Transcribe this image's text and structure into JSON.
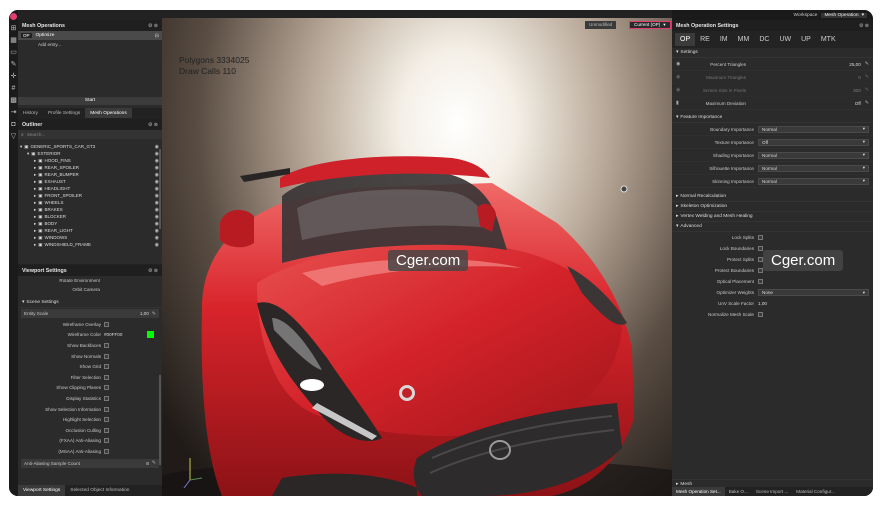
{
  "top_bar": {
    "workspace_label": "Workspace",
    "workspace_value": "Mesh Operation"
  },
  "left_panel": {
    "title": "Mesh Operations",
    "op_badge": "OP",
    "op_name": "Optimize",
    "add_entry": "Add entry...",
    "start_label": "Start",
    "tabs": [
      "History",
      "Profile Settings",
      "Mesh Operations"
    ]
  },
  "outliner": {
    "title": "Outliner",
    "search_placeholder": "Search...",
    "root": "GENERIC_SPORTS_CAR_GT3",
    "child": "EXTERIOR",
    "items": [
      "HOOD_FINS",
      "REAR_SPOILER",
      "REAR_BUMPER",
      "EXHAUST",
      "HEADLIGHT",
      "FRONT_SPOILER",
      "WHEELS",
      "BRAKES",
      "BLOCKER",
      "BODY",
      "REAR_LIGHT",
      "WINDOWS",
      "WINDSHIELD_FRAME"
    ]
  },
  "viewport_settings": {
    "title": "Viewport Settings",
    "rotate_environment": "Rotate Environment",
    "orbit_camera": "Orbit Camera",
    "scene_settings": "Scene Settings",
    "entity_scale_label": "Entity Scale",
    "entity_scale_value": "1,00",
    "rows": [
      "Wireframe Overlay",
      "Wireframe Color",
      "Show Backfaces",
      "Show Normals",
      "Show Grid",
      "Filter Selection",
      "Show Clipping Planes",
      "Display Statistics",
      "Show Selection Information",
      "Highlight Selection",
      "Occlusion Culling",
      "(FXAA) Anti-Aliasing",
      "(MSAA) Anti-Aliasing"
    ],
    "wireframe_color": "#00FF00",
    "aa_count_label": "Anti-Aliasing Sample Count",
    "aa_count_value": "8",
    "bottom_tabs": [
      "Viewport Settings",
      "Selected Object Information"
    ]
  },
  "viewport": {
    "polygons_label": "Polygons 3334025",
    "drawcalls_label": "Draw Calls 110",
    "state_unmodified": "Unmodified",
    "state_current": "Current (OP)",
    "watermark": "Cger.com"
  },
  "right_panel": {
    "title": "Mesh Operation Settings",
    "tabs": [
      "OP",
      "RE",
      "IM",
      "MM",
      "DC",
      "UW",
      "UP",
      "MTK"
    ],
    "settings_title": "Settings",
    "settings": [
      {
        "label": "Percent Triangles",
        "value": "25,00"
      },
      {
        "label": "Maximum Triangles",
        "value": "0"
      },
      {
        "label": "Screen Size in Pixels",
        "value": "300"
      },
      {
        "label": "Maximum Deviation",
        "value": "Off"
      }
    ],
    "feature_title": "Feature Importance",
    "feature": [
      {
        "label": "Boundary Importance",
        "value": "Normal"
      },
      {
        "label": "Texture Importance",
        "value": "Off"
      },
      {
        "label": "Shading Importance",
        "value": "Normal"
      },
      {
        "label": "Silhouette Importance",
        "value": "Normal"
      },
      {
        "label": "Skinning Importance",
        "value": "Normal"
      }
    ],
    "collapsed": [
      "Normal Recalculation",
      "Skeleton Optimization",
      "Vertex Welding and Mesh Healing"
    ],
    "advanced_title": "Advanced",
    "advanced": [
      {
        "label": "Lock Splits"
      },
      {
        "label": "Lock Boundaries"
      },
      {
        "label": "Protect Splits"
      },
      {
        "label": "Protect Boundaries"
      },
      {
        "label": "Optical Placement"
      },
      {
        "label": "Optimizer Weights",
        "value": "None"
      },
      {
        "label": "UnV Scale Factor",
        "value": "1,00"
      },
      {
        "label": "Normalize Mesh Scale"
      }
    ],
    "mesh_section": "Mesh",
    "bottom_tabs": [
      "Mesh Operation Set...",
      "Bake O...",
      "Scene Import ...",
      "Material Configur..."
    ]
  },
  "colors": {
    "accent": "#e23d6f",
    "car_red": "#d8242b"
  }
}
